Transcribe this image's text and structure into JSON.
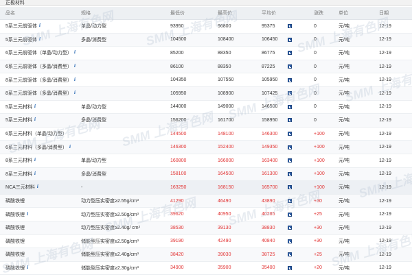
{
  "section": {
    "title": "正极材料"
  },
  "header": {
    "name": "品名",
    "spec": "规格",
    "low": "最低价",
    "high": "最高价",
    "avg": "平均价",
    "change": "涨跌",
    "unit": "单位",
    "date": "日期"
  },
  "watermark": {
    "text": "SMM 上海有色网"
  },
  "colors": {
    "rise": "#e23232",
    "flat": "#333333",
    "info": "#2f6db5",
    "chart_icon": "#2e5fa8"
  },
  "icons": {
    "info": "info-icon",
    "chart": "chart-icon"
  },
  "rows": [
    {
      "name": "5系三元前驱体",
      "info": true,
      "spec": "单晶/动力型",
      "low": "93950",
      "high": "96800",
      "avg": "95375",
      "change": "0",
      "unit": "元/吨",
      "date": "12-19",
      "rise": false
    },
    {
      "name": "5系三元前驱体",
      "info": true,
      "spec": "多晶/消费型",
      "low": "104500",
      "high": "108400",
      "avg": "106450",
      "change": "0",
      "unit": "元/吨",
      "date": "12-19",
      "rise": false
    },
    {
      "name": "6系三元前驱体（单晶/动力型）",
      "info": true,
      "spec": "",
      "low": "85200",
      "high": "88350",
      "avg": "86775",
      "change": "0",
      "unit": "元/吨",
      "date": "12-19",
      "rise": false
    },
    {
      "name": "6系三元前驱体（多晶/消费型）",
      "info": true,
      "spec": "",
      "low": "86100",
      "high": "88350",
      "avg": "87225",
      "change": "0",
      "unit": "元/吨",
      "date": "12-19",
      "rise": false
    },
    {
      "name": "8系三元前驱体（多晶/消费型）",
      "info": true,
      "spec": "",
      "low": "104350",
      "high": "107550",
      "avg": "105950",
      "change": "0",
      "unit": "元/吨",
      "date": "12-19",
      "rise": false
    },
    {
      "name": "8系三元前驱体（多晶/消费型）",
      "info": true,
      "spec": "",
      "low": "105950",
      "high": "108900",
      "avg": "107425",
      "change": "0",
      "unit": "元/吨",
      "date": "12-19",
      "rise": false
    },
    {
      "name": "5系三元材料",
      "info": true,
      "spec": "单晶/动力型",
      "low": "144000",
      "high": "149000",
      "avg": "146500",
      "change": "0",
      "unit": "元/吨",
      "date": "12-19",
      "rise": false
    },
    {
      "name": "5系三元材料",
      "info": true,
      "spec": "多晶/消费型",
      "low": "156200",
      "high": "161700",
      "avg": "158950",
      "change": "0",
      "unit": "元/吨",
      "date": "12-19",
      "rise": false
    },
    {
      "name": "6系三元材料（单晶/动力型）",
      "info": false,
      "spec": "",
      "low": "144500",
      "high": "148100",
      "avg": "146300",
      "change": "+100",
      "unit": "元/吨",
      "date": "12-19",
      "rise": true
    },
    {
      "name": "6系三元材料（多晶/消费型）",
      "info": true,
      "spec": "",
      "low": "146300",
      "high": "152400",
      "avg": "149350",
      "change": "+100",
      "unit": "元/吨",
      "date": "12-19",
      "rise": true
    },
    {
      "name": "8系三元材料",
      "info": true,
      "spec": "单晶/动力型",
      "low": "160800",
      "high": "166000",
      "avg": "163400",
      "change": "+100",
      "unit": "元/吨",
      "date": "12-19",
      "rise": true
    },
    {
      "name": "8系三元材料",
      "info": true,
      "spec": "多晶/消费型",
      "low": "158100",
      "high": "164500",
      "avg": "161300",
      "change": "+100",
      "unit": "元/吨",
      "date": "12-19",
      "rise": true
    },
    {
      "name": "NCA三元材料",
      "info": true,
      "spec": "-",
      "low": "163250",
      "high": "168150",
      "avg": "165700",
      "change": "+100",
      "unit": "元/吨",
      "date": "12-19",
      "rise": true
    },
    {
      "name": "磷酸铁锂",
      "info": false,
      "spec": "动力型压实密度≥2.55g/cm³",
      "low": "41290",
      "high": "46490",
      "avg": "43890",
      "change": "+30",
      "unit": "元/吨",
      "date": "12-19",
      "rise": true
    },
    {
      "name": "磷酸铁锂",
      "info": true,
      "spec": "动力型压实密度≥2.50g/cm³",
      "low": "39620",
      "high": "40950",
      "avg": "40285",
      "change": "+25",
      "unit": "元/吨",
      "date": "12-19",
      "rise": true
    },
    {
      "name": "磷酸铁锂",
      "info": false,
      "spec": "动力型压实密度≥2.40g/ cm³",
      "low": "38530",
      "high": "39130",
      "avg": "38830",
      "change": "+30",
      "unit": "元/吨",
      "date": "12-19",
      "rise": true
    },
    {
      "name": "磷酸铁锂",
      "info": false,
      "spec": "储能型压实密度≥2.50g/cm³",
      "low": "39190",
      "high": "42490",
      "avg": "40840",
      "change": "+30",
      "unit": "元/吨",
      "date": "12-19",
      "rise": true
    },
    {
      "name": "磷酸铁锂",
      "info": false,
      "spec": "储能型压实密度≥2.40g/cm³",
      "low": "38420",
      "high": "39030",
      "avg": "38725",
      "change": "+25",
      "unit": "元/吨",
      "date": "12-19",
      "rise": true
    },
    {
      "name": "磷酸铁锂",
      "info": true,
      "spec": "储能型压实密度≥2.30g/cm³",
      "low": "34900",
      "high": "35900",
      "avg": "35400",
      "change": "+20",
      "unit": "元/吨",
      "date": "12-19",
      "rise": true
    }
  ]
}
